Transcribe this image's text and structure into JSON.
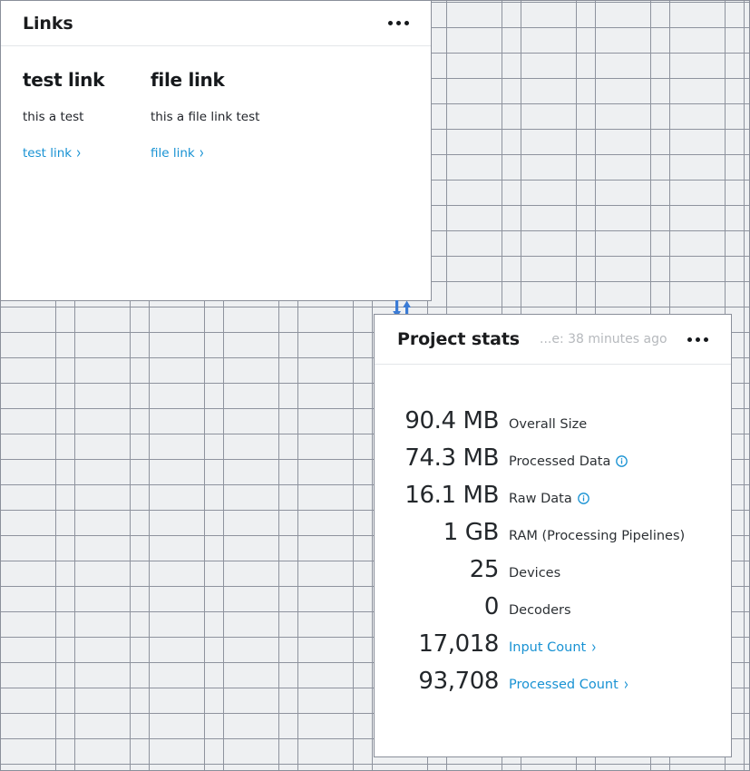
{
  "theme": {
    "accent_blue": "#1892d3",
    "arrow_blue": "#3a7bd5",
    "grid_line": "#8e939e",
    "grid_fill": "#eef0f2",
    "panel_border": "#8a8f9a",
    "muted_text": "#b6b9bd"
  },
  "links_card": {
    "title": "Links",
    "menu_icon": "kebab-menu-icon",
    "columns": [
      {
        "title": "test link",
        "description": "this a test",
        "action_label": "test link",
        "chevron": "›"
      },
      {
        "title": "file link",
        "description": "this a file link test",
        "action_label": "file link",
        "chevron": "›"
      }
    ]
  },
  "swap_arrows": {
    "icon": "sort-arrows-icon",
    "down_arrow": "↓",
    "up_arrow": "↑"
  },
  "stats_card": {
    "title": "Project stats",
    "updated_text": "...e: 38 minutes ago",
    "menu_icon": "kebab-menu-icon",
    "rows": [
      {
        "value": "90.4 MB",
        "label": "Overall Size",
        "info": false,
        "link": false
      },
      {
        "value": "74.3 MB",
        "label": "Processed Data",
        "info": true,
        "link": false
      },
      {
        "value": "16.1 MB",
        "label": "Raw Data",
        "info": true,
        "link": false
      },
      {
        "value": "1 GB",
        "label": "RAM (Processing Pipelines)",
        "info": false,
        "link": false
      },
      {
        "value": "25",
        "label": "Devices",
        "info": false,
        "link": false
      },
      {
        "value": "0",
        "label": "Decoders",
        "info": false,
        "link": false
      },
      {
        "value": "17,018",
        "label": "Input Count",
        "info": false,
        "link": true,
        "chevron": "›"
      },
      {
        "value": "93,708",
        "label": "Processed Count",
        "info": false,
        "link": true,
        "chevron": "›"
      }
    ]
  }
}
